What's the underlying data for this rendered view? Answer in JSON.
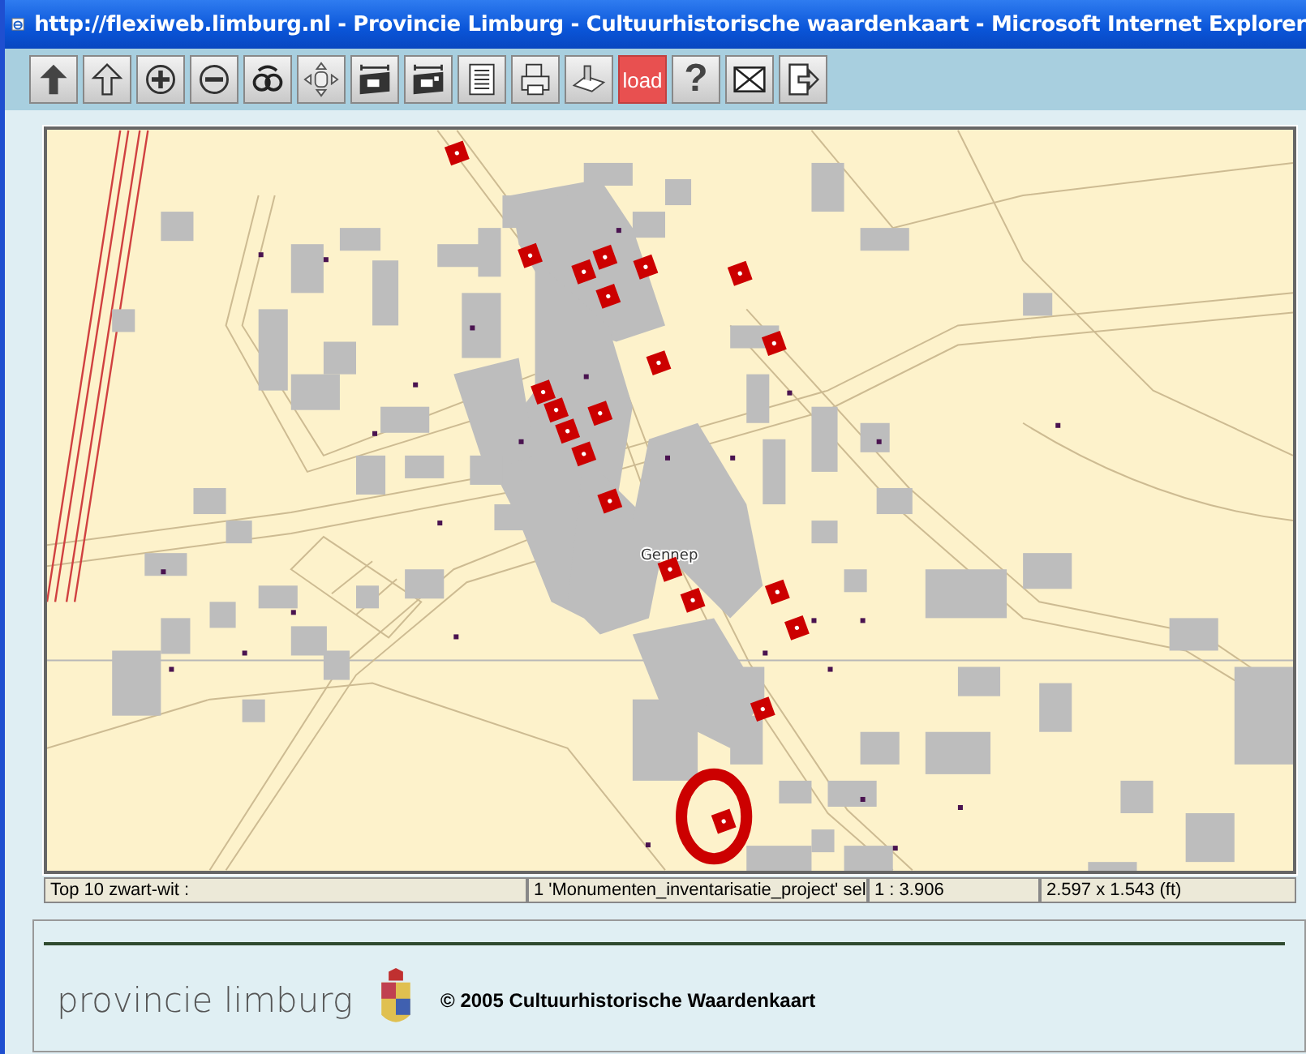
{
  "window": {
    "title": "http://flexiweb.limburg.nl - Provincie Limburg - Cultuurhistorische waardenkaart - Microsoft Internet Explorer"
  },
  "toolbar": [
    {
      "kind": "icon"
    },
    {
      "kind": "icon"
    },
    {
      "kind": "icon"
    },
    {
      "kind": "icon"
    },
    {
      "kind": "icon"
    },
    {
      "kind": "icon"
    },
    {
      "kind": "icon"
    },
    {
      "kind": "icon"
    },
    {
      "kind": "icon"
    },
    {
      "kind": "icon"
    },
    {
      "kind": "icon"
    },
    {
      "kind": "text",
      "label": "load"
    },
    {
      "kind": "glyph",
      "label": "?"
    },
    {
      "kind": "icon"
    },
    {
      "kind": "icon"
    }
  ],
  "map": {
    "place_label": "Gennep"
  },
  "status_bar": [
    "Top 10 zwart-wit :",
    "1 'Monumenten_inventarisatie_project' sel",
    "1 : 3.906",
    "2.597 x 1.543 (ft)"
  ],
  "footer": {
    "logo_text": "provincie limburg",
    "copyright": "© 2005 Cultuurhistorische Waardenkaart"
  }
}
